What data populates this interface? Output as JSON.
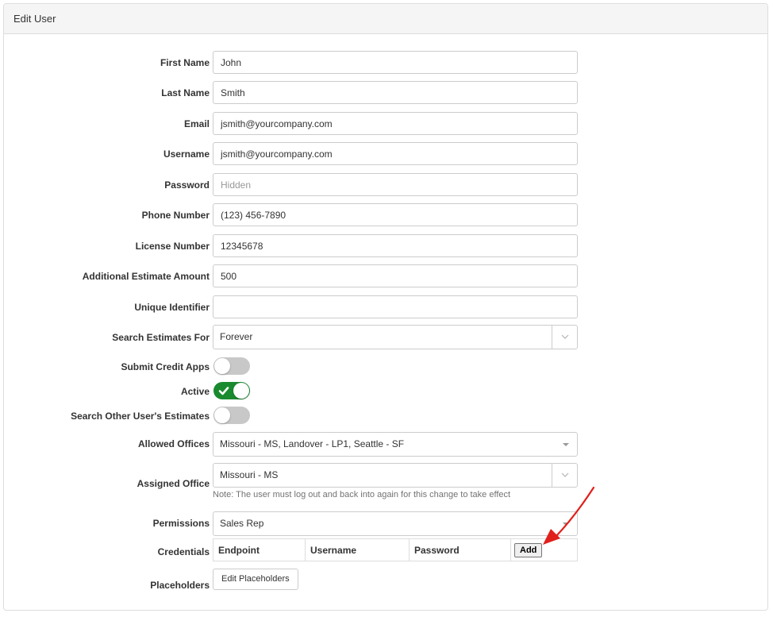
{
  "panel": {
    "title": "Edit User"
  },
  "fields": {
    "first_name": {
      "label": "First Name",
      "value": "John"
    },
    "last_name": {
      "label": "Last Name",
      "value": "Smith"
    },
    "email": {
      "label": "Email",
      "value": "jsmith@yourcompany.com"
    },
    "username": {
      "label": "Username",
      "value": "jsmith@yourcompany.com"
    },
    "password": {
      "label": "Password",
      "value": "",
      "placeholder": "Hidden"
    },
    "phone": {
      "label": "Phone Number",
      "value": "(123) 456-7890"
    },
    "license": {
      "label": "License Number",
      "value": "12345678"
    },
    "additional_estimate": {
      "label": "Additional Estimate Amount",
      "value": "500"
    },
    "unique_identifier": {
      "label": "Unique Identifier",
      "value": ""
    }
  },
  "search_estimates": {
    "label": "Search Estimates For",
    "selected": "Forever"
  },
  "toggles": {
    "submit_credit_apps": {
      "label": "Submit Credit Apps",
      "on": false
    },
    "active": {
      "label": "Active",
      "on": true
    },
    "search_other": {
      "label": "Search Other User's Estimates",
      "on": false
    }
  },
  "allowed_offices": {
    "label": "Allowed Offices",
    "selected": "Missouri - MS, Landover - LP1, Seattle - SF"
  },
  "assigned_office": {
    "label": "Assigned Office",
    "selected": "Missouri - MS",
    "note": "Note: The user must log out and back into again for this change to take effect"
  },
  "permissions": {
    "label": "Permissions",
    "selected": "Sales Rep"
  },
  "credentials": {
    "label": "Credentials",
    "columns": [
      "Endpoint",
      "Username",
      "Password"
    ],
    "add_label": "Add"
  },
  "placeholders": {
    "label": "Placeholders",
    "button": "Edit Placeholders"
  },
  "colors": {
    "toggle_on": "#1a8a2e",
    "toggle_off": "#c8c8c8",
    "arrow": "#e0201b"
  }
}
